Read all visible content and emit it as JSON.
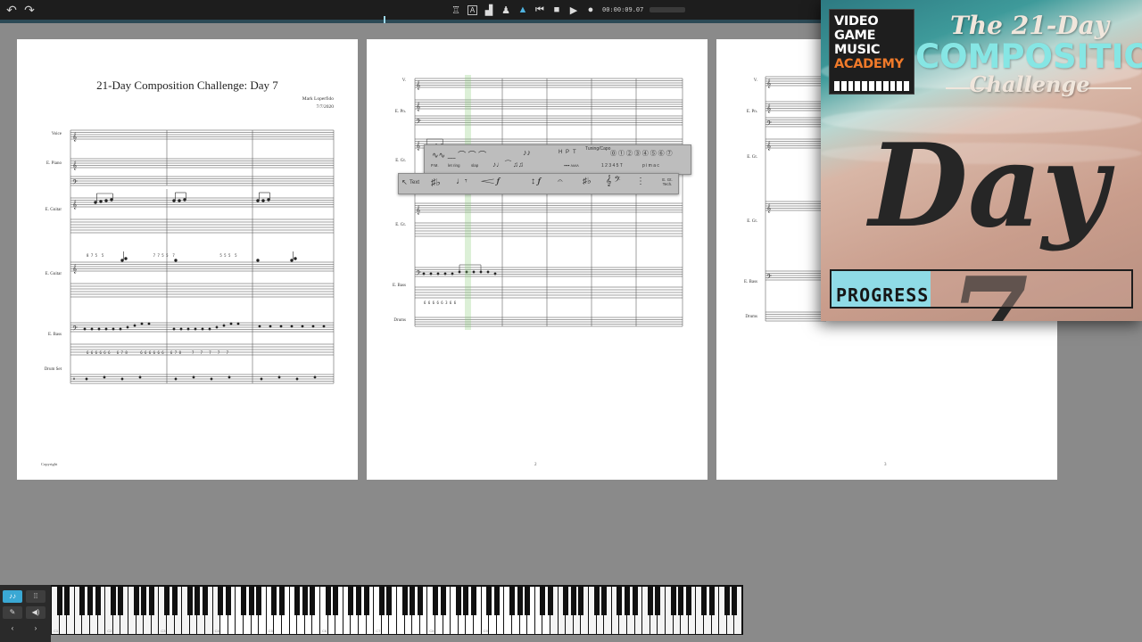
{
  "score": {
    "title": "21-Day Composition Challenge: Day 7",
    "composer": "Mark Loperfido",
    "date": "7/7/2020",
    "copyright": "Copyright",
    "page_numbers": [
      "2",
      "3"
    ],
    "page1_instruments": [
      "Voice",
      "E. Piano",
      "E. Guitar",
      "E. Guitar",
      "E. Bass",
      "Drum Set"
    ],
    "page2_instruments": [
      "V.",
      "E. Pn.",
      "E. Gt.",
      "E. Gt.",
      "E. Bass",
      "Drums"
    ],
    "page3_instruments": [
      "V.",
      "E. Pn.",
      "E. Gt.",
      "E. Gt.",
      "E. Bass",
      "Drums"
    ],
    "tab_numbers": {
      "gtr1": [
        "8 7 5  5",
        "7 7 5 5  7",
        "5 5 5  5"
      ],
      "bass": [
        "6 6 6 6 6 6   6 7 8",
        "6 6 6 6 6 6   6 7 8",
        "7   7   7   7   7"
      ],
      "bass_p2": "6 6 6 6 6 3 6 6"
    }
  },
  "palettes": {
    "top_row1": [
      "H",
      "P",
      "T",
      "Tuning/Capo",
      "⓪ ① ② ③ ④ ⑤ ⑥ ⑦"
    ],
    "top_row2": [
      "P.M.",
      "let ring",
      "slap",
      "1 2 3 4 5 T",
      "p i m a c"
    ],
    "bottom": [
      "Text",
      "E. Gt. Tech."
    ]
  },
  "transport": {
    "time": "00:00:09.07"
  },
  "promo": {
    "logo_lines": [
      "VIDEO",
      "GAME",
      "MUSIC",
      "ACADEMY"
    ],
    "heading_top": "The 21-Day",
    "heading_main": "COMPOSITION",
    "heading_sub": "Challenge",
    "day_label": "Day 7",
    "progress_label": "PROGRESS",
    "progress_fraction": 0.33,
    "colors": {
      "accent": "#86e6e4",
      "logo_accent": "#f07a2a",
      "progress_fill": "#8fdbe6"
    }
  },
  "keyboard": {
    "octave_labels": [
      "C1",
      "C2",
      "C3",
      "C4",
      "C5",
      "C6",
      "C7",
      "C8",
      "C9"
    ]
  },
  "icons": [
    "undo-icon",
    "redo-icon",
    "metronome-icon",
    "rewind-icon",
    "stop-icon",
    "play-icon",
    "record-icon",
    "piano-mode-icon",
    "pencil-icon",
    "speaker-icon"
  ]
}
